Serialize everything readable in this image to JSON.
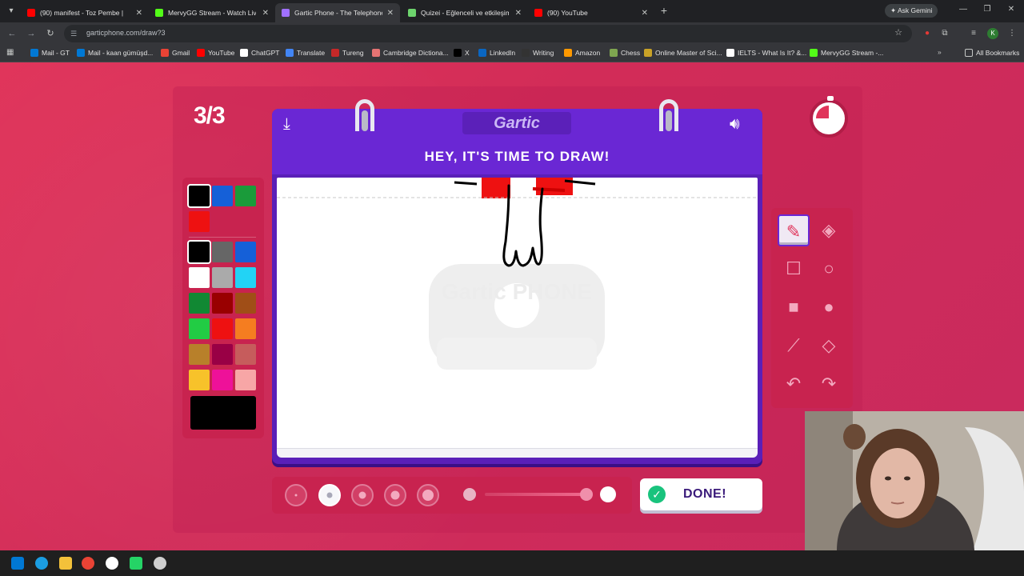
{
  "browser": {
    "tabs": [
      {
        "title": "(90) manifest - Toz Pembe |",
        "favicon_color": "#ff0000",
        "active": false
      },
      {
        "title": "MervyGG Stream - Watch Live",
        "favicon_color": "#53fc18",
        "active": false
      },
      {
        "title": "Gartic Phone - The Telephone",
        "favicon_color": "#a070ff",
        "active": true
      },
      {
        "title": "Quizei - Eğlenceli ve etkileşimli",
        "favicon_color": "#6dd46d",
        "active": false
      },
      {
        "title": "(90) YouTube",
        "favicon_color": "#ff0000",
        "active": false
      }
    ],
    "new_tab_label": "+",
    "ask_gemini_label": "Ask Gemini",
    "url": "garticphone.com/draw?3",
    "bookmarks": [
      {
        "label": "Mail - GT",
        "color": "#0078d4"
      },
      {
        "label": "Mail - kaan gümüşd...",
        "color": "#0078d4"
      },
      {
        "label": "Gmail",
        "color": "#ea4335"
      },
      {
        "label": "YouTube",
        "color": "#ff0000"
      },
      {
        "label": "ChatGPT",
        "color": "#ffffff"
      },
      {
        "label": "Translate",
        "color": "#4285f4"
      },
      {
        "label": "Tureng",
        "color": "#c62828"
      },
      {
        "label": "Cambridge Dictiona...",
        "color": "#e57373"
      },
      {
        "label": "X",
        "color": "#000000"
      },
      {
        "label": "LinkedIn",
        "color": "#0a66c2"
      },
      {
        "label": "Writing",
        "color": "#333333"
      },
      {
        "label": "Amazon",
        "color": "#ff9900"
      },
      {
        "label": "Chess",
        "color": "#7fa650"
      },
      {
        "label": "Online Master of Sci...",
        "color": "#c9a227"
      },
      {
        "label": "IELTS - What Is It? &...",
        "color": "#ffffff"
      },
      {
        "label": "MervyGG Stream -...",
        "color": "#53fc18"
      }
    ],
    "all_bookmarks_label": "All Bookmarks"
  },
  "game": {
    "round": "3/3",
    "logo": "Gartic",
    "instruction": "HEY, IT'S TIME TO DRAW!",
    "watermark": "Gartic PHONE",
    "done_label": "DONE!",
    "selected_tool": "pencil",
    "selected_brush_size_index": 1,
    "current_color": "#000000",
    "recent_colors": [
      "#000000",
      "#1560d8",
      "#1a9b3a",
      "#ee1111"
    ],
    "palette_colors": [
      "#000000",
      "#666666",
      "#1560d8",
      "#ffffff",
      "#aaaaaa",
      "#22d3f5",
      "#118833",
      "#990000",
      "#a04e17",
      "#22cc44",
      "#ee1111",
      "#f57d20",
      "#b8802a",
      "#990045",
      "#c65c5c",
      "#f7c22a",
      "#ee1199",
      "#f7a6a6"
    ],
    "tools": [
      {
        "name": "pencil",
        "icon": "pencil-icon"
      },
      {
        "name": "eraser",
        "icon": "eraser-icon"
      },
      {
        "name": "rectangle",
        "icon": "rectangle-outline-icon"
      },
      {
        "name": "ellipse",
        "icon": "circle-outline-icon"
      },
      {
        "name": "filled-rectangle",
        "icon": "rectangle-filled-icon"
      },
      {
        "name": "filled-ellipse",
        "icon": "circle-filled-icon"
      },
      {
        "name": "line",
        "icon": "line-icon"
      },
      {
        "name": "fill",
        "icon": "paint-bucket-icon"
      },
      {
        "name": "undo",
        "icon": "undo-icon"
      },
      {
        "name": "redo",
        "icon": "redo-icon"
      }
    ],
    "accent": "#e0345a",
    "board_color": "#5a1fb8"
  }
}
